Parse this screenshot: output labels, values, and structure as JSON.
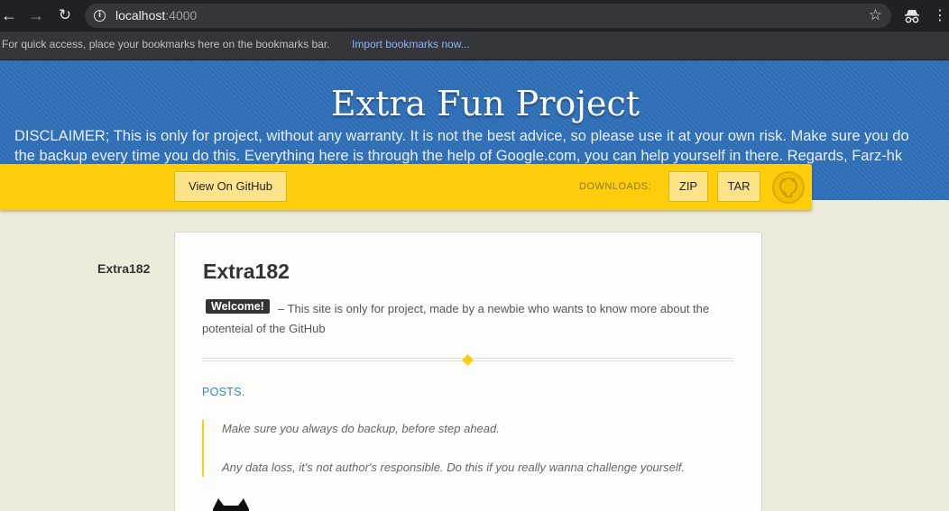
{
  "browser": {
    "url_host": "localhost",
    "url_port": ":4000",
    "bookmarks_bar_text": "For quick access, place your bookmarks here on the bookmarks bar.",
    "import_bookmarks_label": "Import bookmarks now..."
  },
  "header": {
    "title": "Extra Fun Project",
    "disclaimer_line1": "DISCLAIMER; This is only for project, without any warranty. It is not the best advice, so please use it at your own risk. Make sure you do",
    "disclaimer_line2": "the backup every time you do this. Everything here is through the help of Google.com, you can help yourself in there. Regards, Farz-hk"
  },
  "ribbon": {
    "github_button": "View On GitHub",
    "downloads_label": "DOWNLOADS:",
    "zip_button": "ZIP",
    "tar_button": "TAR"
  },
  "sidebar": {
    "title": "Extra182"
  },
  "post": {
    "title": "Extra182",
    "badge": "Welcome!",
    "intro": "– This site is only for project, made by a newbie who wants to know more about the potenteial of the GitHub",
    "posts_link": "POSTS.",
    "quotes": [
      "Make sure you always do backup, before step ahead.",
      "Any data loss, it's not author's responsible. Do this if you really wanna challenge yourself."
    ]
  },
  "colors": {
    "header_blue": "#2f6fb8",
    "ribbon_yellow": "#fecd0c",
    "link_blue": "#2a8fb4",
    "page_bg": "#eeebda"
  }
}
